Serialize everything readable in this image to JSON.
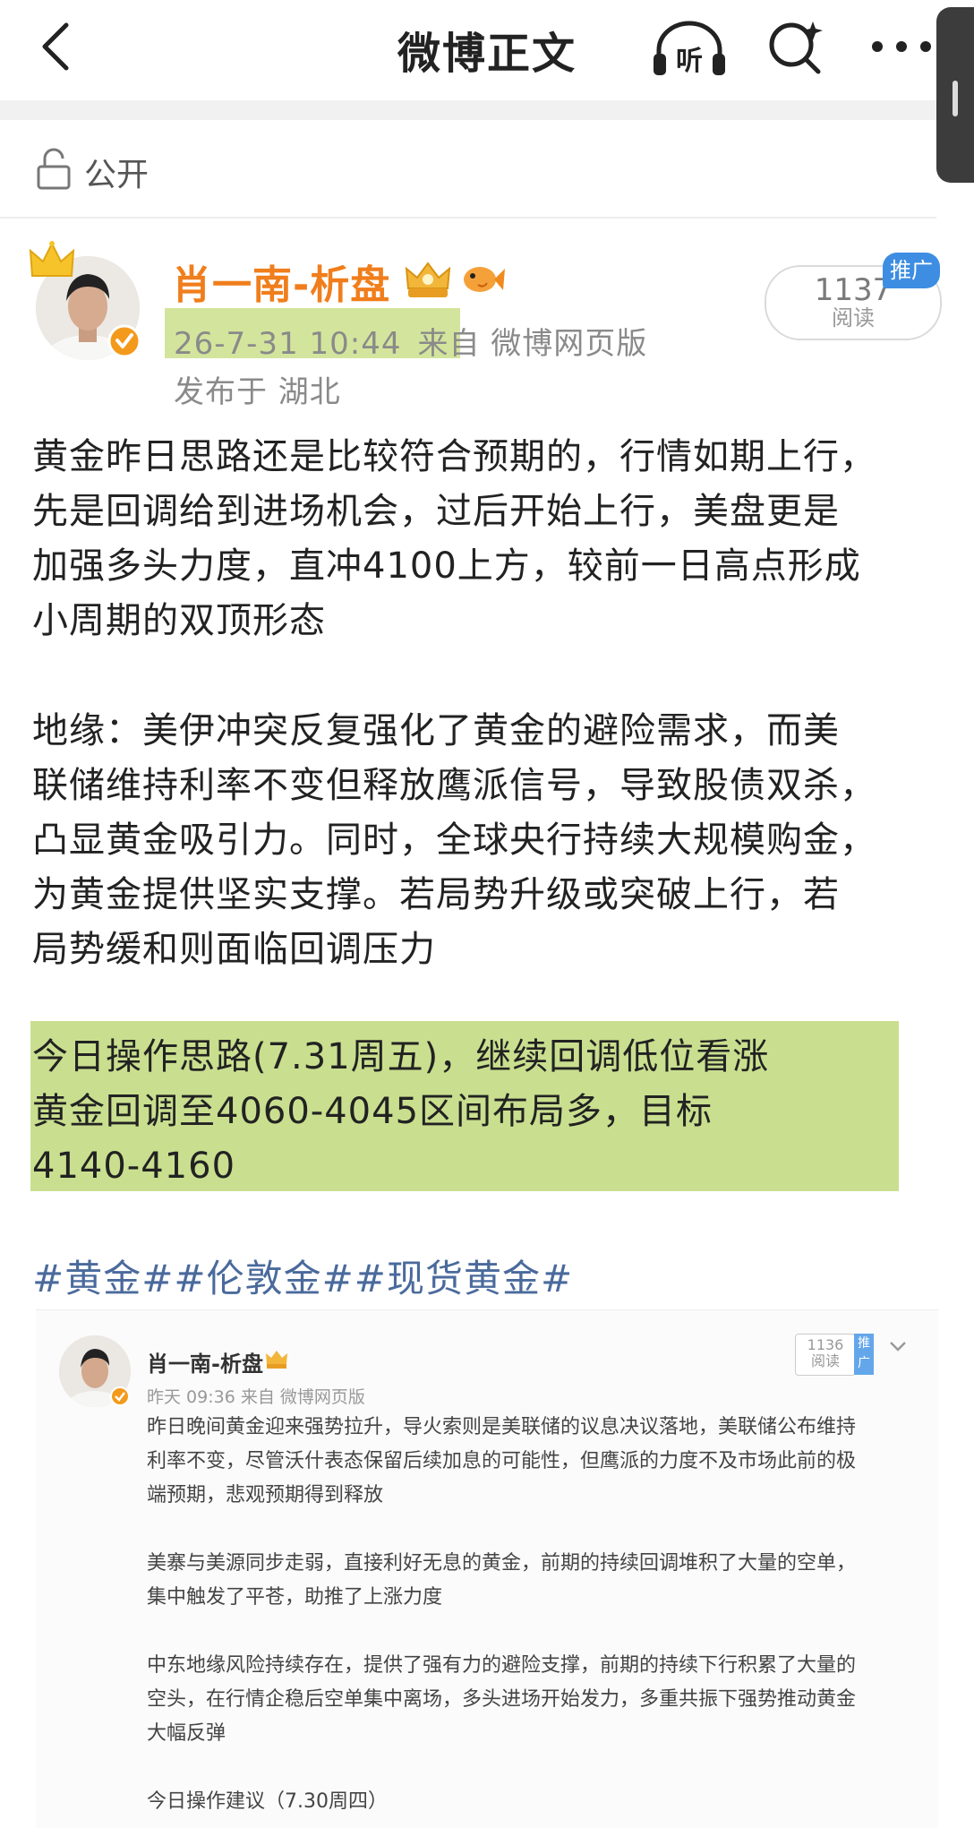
{
  "nav": {
    "title": "微博正文",
    "listen_label": "听"
  },
  "visibility": {
    "label": "公开"
  },
  "post": {
    "author": "肖一南-析盘",
    "time": "26-7-31 10:44",
    "source": "来自 微博网页版",
    "location": "发布于 湖北",
    "read_count": "1137",
    "read_label": "阅读",
    "promo": "推广",
    "paragraphs": [
      "黄金昨日思路还是比较符合预期的，行情如期上行，\n先是回调给到进场机会，过后开始上行，美盘更是\n加强多头力度，直冲4100上方，较前一日高点形成\n小周期的双顶形态",
      "地缘：美伊冲突反复强化了黄金的避险需求，而美\n联储维持利率不变但释放鹰派信号，导致股债双杀，\n凸显黄金吸引力。同时，全球央行持续大规模购金，\n为黄金提供坚实支撑。若局势升级或突破上行，若\n局势缓和则面临回调压力",
      "今日操作思路(7.31周五)，继续回调低位看涨\n黄金回调至4060-4045区间布局多，目标\n4140-4160"
    ],
    "hashtags": "#黄金##伦敦金##现货黄金#"
  },
  "embed": {
    "author": "肖一南-析盘",
    "meta": "昨天 09:36  来自 微博网页版",
    "read_count": "1136",
    "read_label": "阅读",
    "promo": "推广",
    "body": "昨日晚间黄金迎来强势拉升，导火索则是美联储的议息决议落地，美联储公布维持\n利率不变，尽管沃什表态保留后续加息的可能性，但鹰派的力度不及市场此前的极\n端预期，悲观预期得到释放\n\n美寨与美源同步走弱，直接利好无息的黄金，前期的持续回调堆积了大量的空单，\n集中触发了平苍，助推了上涨力度\n\n中东地缘风险持续存在，提供了强有力的避险支撑，前期的持续下行积累了大量的\n空头，在行情企稳后空单集中离场，多头进场开始发力，多重共振下强势推动黄金\n大幅反弹\n\n今日操作建议（7.30周四）"
  },
  "colors": {
    "author_orange": "#f07e1c",
    "hashtag_blue": "#4a6a9c",
    "highlight_green": "#c9df8f",
    "promo_blue": "#3d8de2"
  }
}
